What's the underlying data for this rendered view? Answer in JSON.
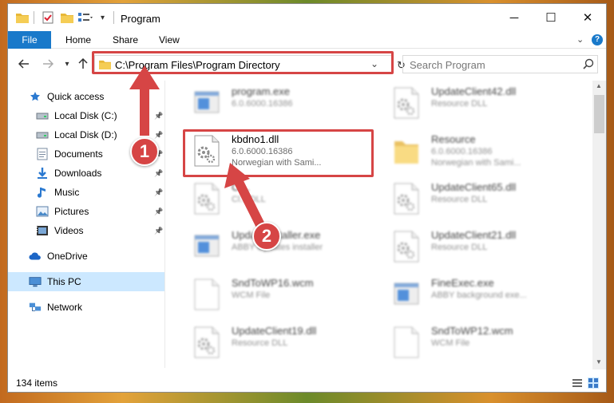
{
  "window": {
    "title": "Program",
    "minimize": "─",
    "maximize": "☐",
    "close": "✕"
  },
  "ribbon": {
    "file": "File",
    "home": "Home",
    "share": "Share",
    "view": "View",
    "help": "?"
  },
  "nav": {
    "address": "C:\\Program Files\\Program Directory",
    "search_placeholder": "Search Program"
  },
  "sidebar": {
    "items": [
      {
        "label": "Quick access",
        "icon": "star-icon",
        "pinned": false
      },
      {
        "label": "Local Disk (C:)",
        "icon": "drive-icon",
        "pinned": true
      },
      {
        "label": "Local Disk (D:)",
        "icon": "drive-icon",
        "pinned": true
      },
      {
        "label": "Documents",
        "icon": "documents-icon",
        "pinned": true
      },
      {
        "label": "Downloads",
        "icon": "downloads-icon",
        "pinned": true
      },
      {
        "label": "Music",
        "icon": "music-icon",
        "pinned": true
      },
      {
        "label": "Pictures",
        "icon": "pictures-icon",
        "pinned": true
      },
      {
        "label": "Videos",
        "icon": "videos-icon",
        "pinned": true
      },
      {
        "label": "OneDrive",
        "icon": "cloud-icon",
        "pinned": false
      },
      {
        "label": "This PC",
        "icon": "computer-icon",
        "pinned": false,
        "selected": true
      },
      {
        "label": "Network",
        "icon": "network-icon",
        "pinned": false
      }
    ]
  },
  "files": [
    {
      "name": "program.exe",
      "line1": "6.0.6000.16386",
      "line2": "",
      "icon": "exe-icon",
      "focus": false
    },
    {
      "name": "UpdateClient42.dll",
      "line1": "Resource DLL",
      "line2": "",
      "icon": "dll-icon",
      "focus": false
    },
    {
      "name": "kbdno1.dll",
      "line1": "6.0.6000.16386",
      "line2": "Norwegian with Sami...",
      "icon": "dll-icon",
      "focus": true
    },
    {
      "name": "Resource",
      "line1": "6.0.6000.16386",
      "line2": "Norwegian with Sami...",
      "icon": "folder-icon",
      "focus": false
    },
    {
      "name": "Cl...",
      "line1": "Cl... DLL",
      "line2": "",
      "icon": "dll-icon",
      "focus": false
    },
    {
      "name": "UpdateClient65.dll",
      "line1": "Resource DLL",
      "line2": "",
      "icon": "dll-icon",
      "focus": false
    },
    {
      "name": "UpdateInstaller.exe",
      "line1": "ABBY Updates installer",
      "line2": "",
      "icon": "exe-icon",
      "focus": false
    },
    {
      "name": "UpdateClient21.dll",
      "line1": "Resource DLL",
      "line2": "",
      "icon": "dll-icon",
      "focus": false
    },
    {
      "name": "SndToWP16.wcm",
      "line1": "WCM File",
      "line2": "",
      "icon": "file-icon",
      "focus": false
    },
    {
      "name": "FineExec.exe",
      "line1": "ABBY background exe...",
      "line2": "",
      "icon": "exe-icon",
      "focus": false
    },
    {
      "name": "UpdateClient19.dll",
      "line1": "Resource DLL",
      "line2": "",
      "icon": "dll-icon",
      "focus": false
    },
    {
      "name": "SndToWP12.wcm",
      "line1": "WCM File",
      "line2": "",
      "icon": "file-icon",
      "focus": false
    }
  ],
  "status": {
    "count": "134 items"
  },
  "annotations": {
    "step1": "1",
    "step2": "2",
    "color": "#d64545"
  }
}
